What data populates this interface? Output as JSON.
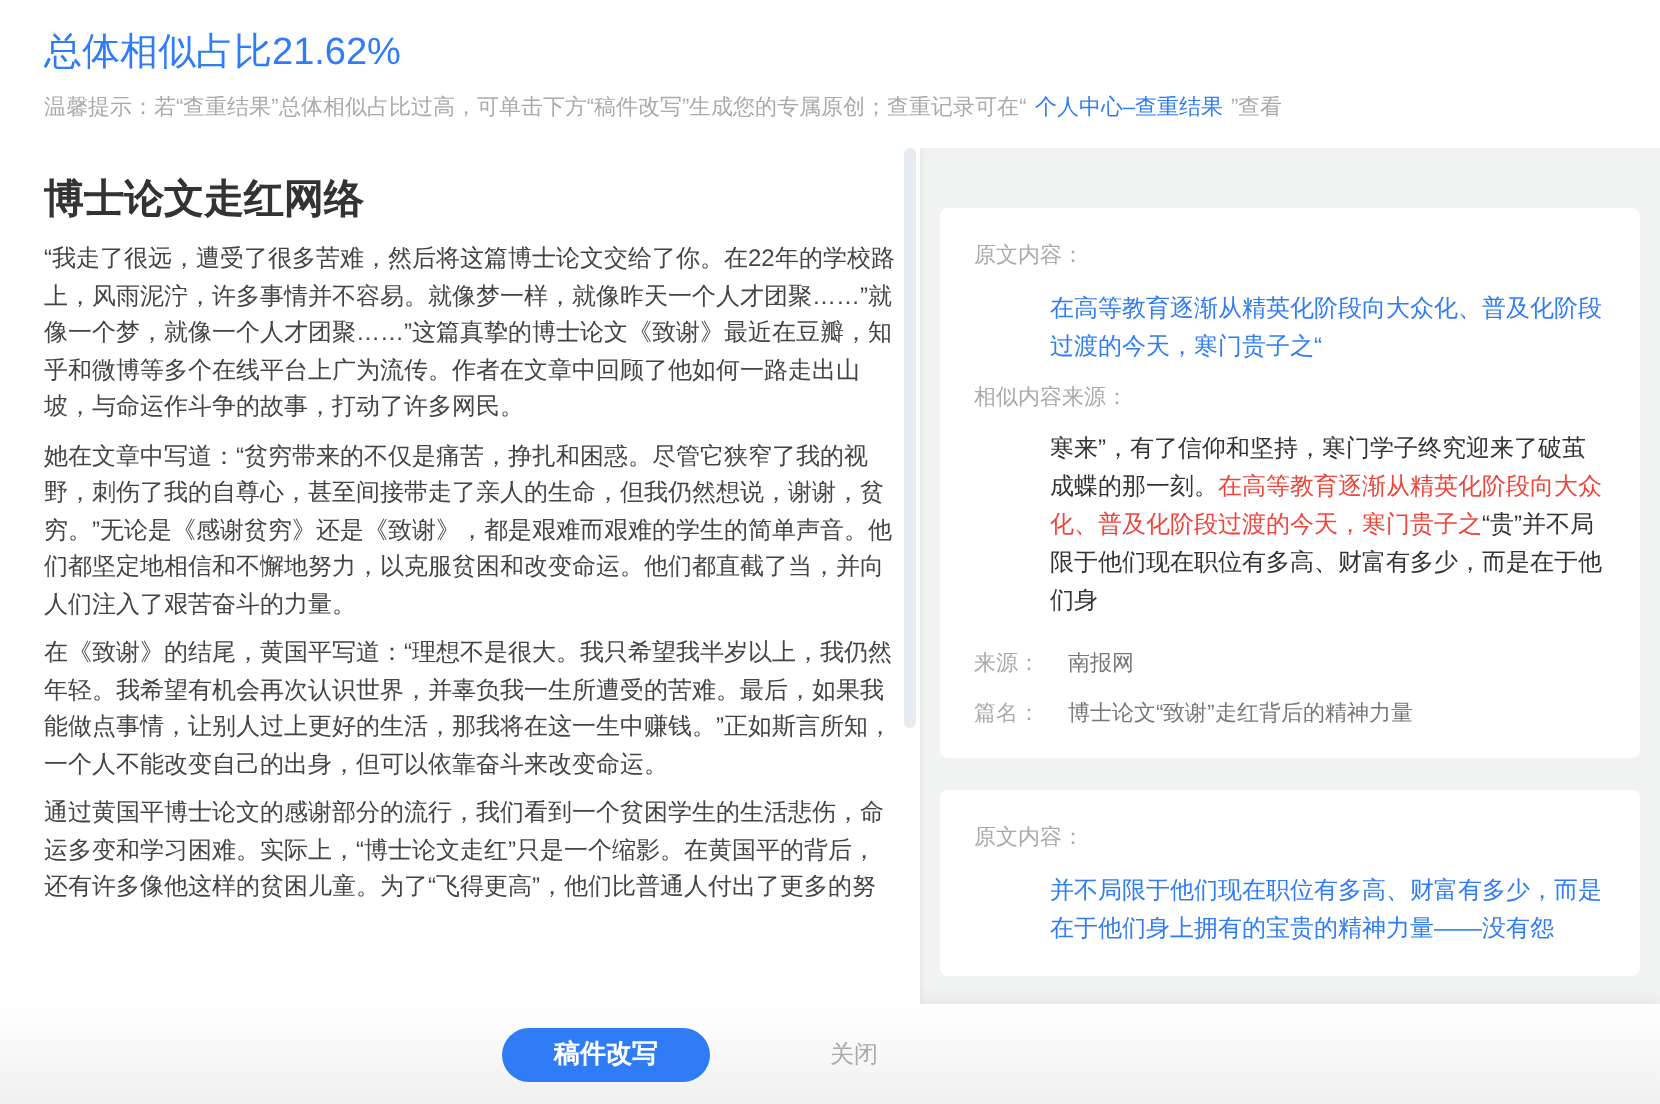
{
  "header": {
    "title": "总体相似占比21.62%",
    "hint": [
      {
        "kind": "text",
        "text": "温馨提示：若“查重结果”总体相似占比过高，可单击下方“稿件改写”生成您的专属原创；查重记录可在“"
      },
      {
        "kind": "link",
        "text": "个人中心–查重结果"
      },
      {
        "kind": "text",
        "text": "”查看"
      }
    ]
  },
  "article": {
    "title": "博士论文走红网络",
    "paragraphs": [
      "“我走了很远，遭受了很多苦难，然后将这篇博士论文交给了你。在22年的学校路上，风雨泥泞，许多事情并不容易。就像梦一样，就像昨天一个人才团聚……”就像一个梦，就像一个人才团聚……”这篇真挚的博士论文《致谢》最近在豆瓣，知乎和微博等多个在线平台上广为流传。作者在文章中回顾了他如何一路走出山坡，与命运作斗争的故事，打动了许多网民。",
      "她在文章中写道：“贫穷带来的不仅是痛苦，挣扎和困惑。尽管它狭窄了我的视野，刺伤了我的自尊心，甚至间接带走了亲人的生命，但我仍然想说，谢谢，贫穷。”无论是《感谢贫穷》还是《致谢》，都是艰难而艰难的学生的简单声音。他们都坚定地相信和不懈地努力，以克服贫困和改变命运。他们都直截了当，并向人们注入了艰苦奋斗的力量。",
      "在《致谢》的结尾，黄国平写道：“理想不是很大。我只希望我半岁以上，我仍然年轻。我希望有机会再次认识世界，并辜负我一生所遭受的苦难。最后，如果我能做点事情，让别人过上更好的生活，那我将在这一生中赚钱。”正如斯言所知，一个人不能改变自己的出身，但可以依靠奋斗来改变命运。",
      "通过黄国平博士论文的感谢部分的流行，我们看到一个贫困学生的生活悲伤，命运多变和学习困难。实际上，“博士论文走红”只是一个缩影。在黄国平的背后，还有许多像他这样的贫困儿童。为了“飞得更高”，他们比普通人付出了更多的努"
    ]
  },
  "matches": [
    {
      "original_label": "原文内容：",
      "original": "在高等教育逐渐从精英化阶段向大众化、普及化阶段过渡的今天，寒门贵子之“",
      "similar_label": "相似内容来源：",
      "similar": [
        {
          "highlight": false,
          "text": "寒来”，有了信仰和坚持，寒门学子终究迎来了破茧成蝶的那一刻。"
        },
        {
          "highlight": true,
          "text": "在高等教育逐渐从精英化阶段向大众化、普及化阶段过渡的今天，寒门贵子之"
        },
        {
          "highlight": false,
          "text": "“贵”并不局限于他们现在职位有多高、财富有多少，而是在于他们身"
        }
      ],
      "source_label": "来源：",
      "source": "南报网",
      "title_label": "篇名：",
      "title": "博士论文“致谢”走红背后的精神力量"
    },
    {
      "original_label": "原文内容：",
      "original": "并不局限于他们现在职位有多高、财富有多少，而是在于他们身上拥有的宝贵的精神力量——没有怨"
    }
  ],
  "footer": {
    "rewrite_button": "稿件改写",
    "close_button": "关闭"
  }
}
